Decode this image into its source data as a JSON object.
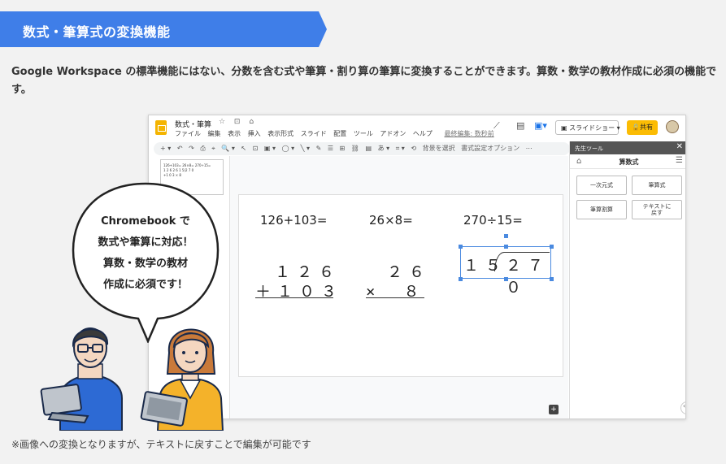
{
  "banner": {
    "title": "数式・筆算式の変換機能"
  },
  "description": "Google Workspace の標準機能にはない、分数を含む式や筆算・割り算の筆算に変換することができます。算数・数学の教材作成に必須の機能です。",
  "footnote": "※画像への変換となりますが、テキストに戻すことで編集が可能です",
  "app": {
    "doc_title": "数式・筆算",
    "title_icons": "☆ ⊡ ⌂",
    "menus": [
      "ファイル",
      "編集",
      "表示",
      "挿入",
      "表示形式",
      "スライド",
      "配置",
      "ツール",
      "アドオン",
      "ヘルプ"
    ],
    "last_edit": "最終編集: 数秒前",
    "present_label": "スライドショー",
    "share_label": "共有",
    "toolbar_items": [
      "+ ▾",
      "↶",
      "↷",
      "⎙",
      "⌖",
      "🔍 ▾",
      "↖",
      "⊡",
      "▣ ▾",
      "◯ ▾",
      "╲ ▾",
      "✎",
      "☰",
      "⊞",
      "⛓",
      "▤",
      "あ ▾",
      "⌗ ▾",
      "⟲"
    ],
    "toolbar_bg_label": "背景を選択",
    "toolbar_fmt_label": "書式設定オプション",
    "thumbnail": {
      "line1": "126+103=   26×8=   270÷15=",
      "line2": "  1 2 6     2 6    1 5)2 7 0",
      "line3": "+1 0 3    ×  8"
    },
    "slide": {
      "eq1": "126+103=",
      "eq2": "26×8=",
      "eq3": "270÷15=",
      "col1_top": "１２６",
      "col1_bottom": "＋１０３",
      "col2_top": "２６",
      "col2_bottom": "×　８",
      "div_divisor": "１５",
      "div_dividend": "２７０"
    },
    "panel": {
      "header": "先生ツール",
      "title": "算数式",
      "btn_linear": "一次元式",
      "btn_column": "筆算式",
      "btn_division": "筆算割算",
      "btn_revert": "テキストに\n戻す"
    }
  },
  "bubble": {
    "line1": "Chromebook で",
    "line2": "数式や筆算に対応！",
    "line3": "算数・数学の教材",
    "line4": "作成に必須です！"
  },
  "colors": {
    "banner": "#3f7ee8",
    "share": "#fbbc04",
    "selection": "#4a8ae0"
  }
}
